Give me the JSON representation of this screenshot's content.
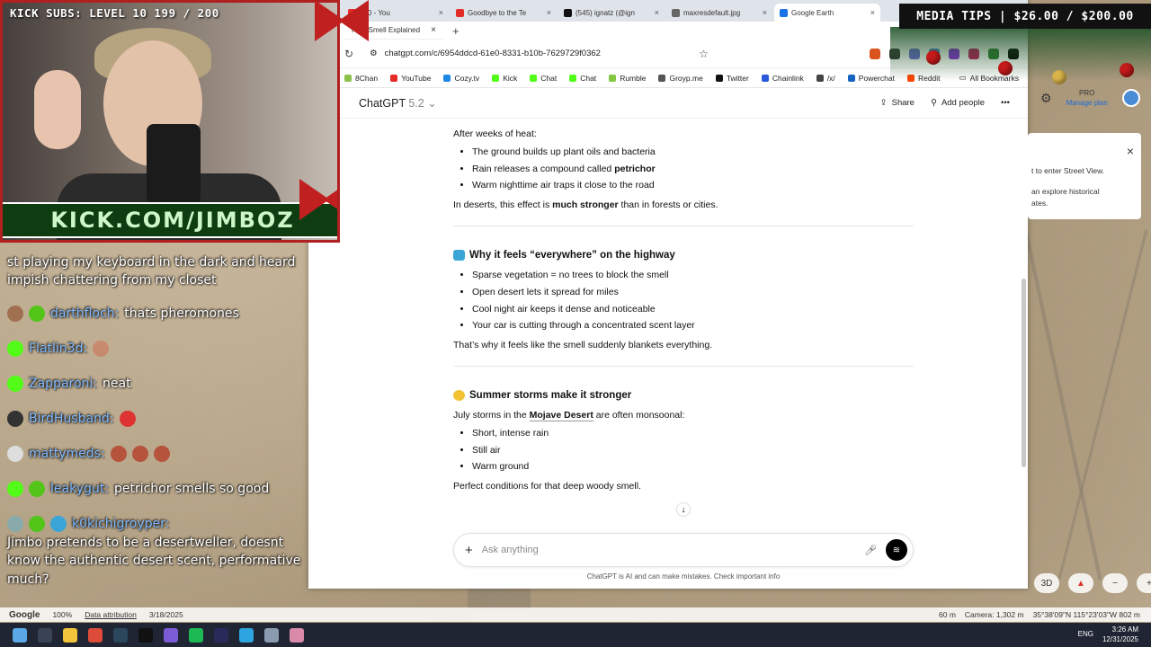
{
  "overlay": {
    "subs_text": "KICK SUBS: LEVEL 10 199 / 200",
    "kick_banner": "KICK.COM/JIMBOZ",
    "media_tips": "MEDIA TIPS | $26.00 / $200.00"
  },
  "stream_chat": [
    {
      "user": "",
      "text": "st playing my keyboard in the dark and heard impish chattering from my closet"
    },
    {
      "user": "darthfloch:",
      "text": "thats pheromones"
    },
    {
      "user": "Flatlin3d:",
      "text": ""
    },
    {
      "user": "Zapparoni:",
      "text": "neat"
    },
    {
      "user": "BirdHusband:",
      "text": ""
    },
    {
      "user": "mattymeds:",
      "text": ""
    },
    {
      "user": "leakygut:",
      "text": "petrichor smells so good"
    },
    {
      "user": "k0kichigroyper:",
      "text": "Jimbo pretends to be a desertweller, doesnt know the authentic desert scent, performative much?"
    }
  ],
  "browser": {
    "tabs": [
      {
        "label": "n10 - You",
        "color": "#e52d27"
      },
      {
        "label": "Goodbye to the Te",
        "color": "#e52d27"
      },
      {
        "label": "(545) ignatz (@ign",
        "color": "#111111"
      },
      {
        "label": "maxresdefault.jpg",
        "color": "#666666"
      },
      {
        "label": "Google Earth",
        "color": "#1a73e8"
      }
    ],
    "active_tab": "Rain Smell Explained",
    "url": "chatgpt.com/c/6954ddcd-61e0-8331-b10b-7629729f0362",
    "bookmarks": [
      "8Chan",
      "YouTube",
      "Cozy.tv",
      "Kick",
      "Chat",
      "Chat",
      "Rumble",
      "Groyp.me",
      "Twitter",
      "Chainlink",
      "/x/",
      "Powerchat",
      "Reddit"
    ],
    "all_bookmarks": "All Bookmarks"
  },
  "chatgpt": {
    "model": "ChatGPT",
    "version": "5.2",
    "share": "Share",
    "add_people": "Add people",
    "intro": "After weeks of heat:",
    "list1": [
      {
        "pre": "The ground builds up plant oils and bacteria",
        "bold": ""
      },
      {
        "pre": "Rain releases a compound called ",
        "bold": "petrichor"
      },
      {
        "pre": "Warm nighttime air traps it close to the road",
        "bold": ""
      }
    ],
    "p1_pre": "In deserts, this effect is ",
    "p1_bold": "much stronger",
    "p1_post": " than in forests or cities.",
    "h2": "Why it feels “everywhere” on the highway",
    "list2": [
      "Sparse vegetation = no trees to block the smell",
      "Open desert lets it spread for miles",
      "Cool night air keeps it dense and noticeable",
      "Your car is cutting through a concentrated scent layer"
    ],
    "p2": "That’s why it feels like the smell suddenly blankets everything.",
    "h3": "Summer storms make it stronger",
    "p3_pre": "July storms in the ",
    "p3_link": "Mojave Desert",
    "p3_post": " are often monsoonal:",
    "list3": [
      "Short, intense rain",
      "Still air",
      "Warm ground"
    ],
    "p4": "Perfect conditions for that deep woody smell.",
    "composer_placeholder": "Ask anything",
    "disclaimer": "ChatGPT is AI and can make mistakes. Check important info"
  },
  "google_earth": {
    "pro": "PRO",
    "manage_plan": "Manage plan",
    "panel_line1": "t to enter Street View.",
    "panel_line2": "an explore historical",
    "panel_line3": "ates.",
    "google": "Google",
    "zoom": "100%",
    "attribution": "Data attribution",
    "date": "3/18/2025",
    "scale": "60 m",
    "camera": "Camera: 1,302 m",
    "coords": "35°38'09\"N 115°23'03\"W 802 m",
    "btn_3d": "3D"
  },
  "taskbar": {
    "lang": "ENG",
    "time": "3:26 AM",
    "date": "12/31/2025"
  }
}
